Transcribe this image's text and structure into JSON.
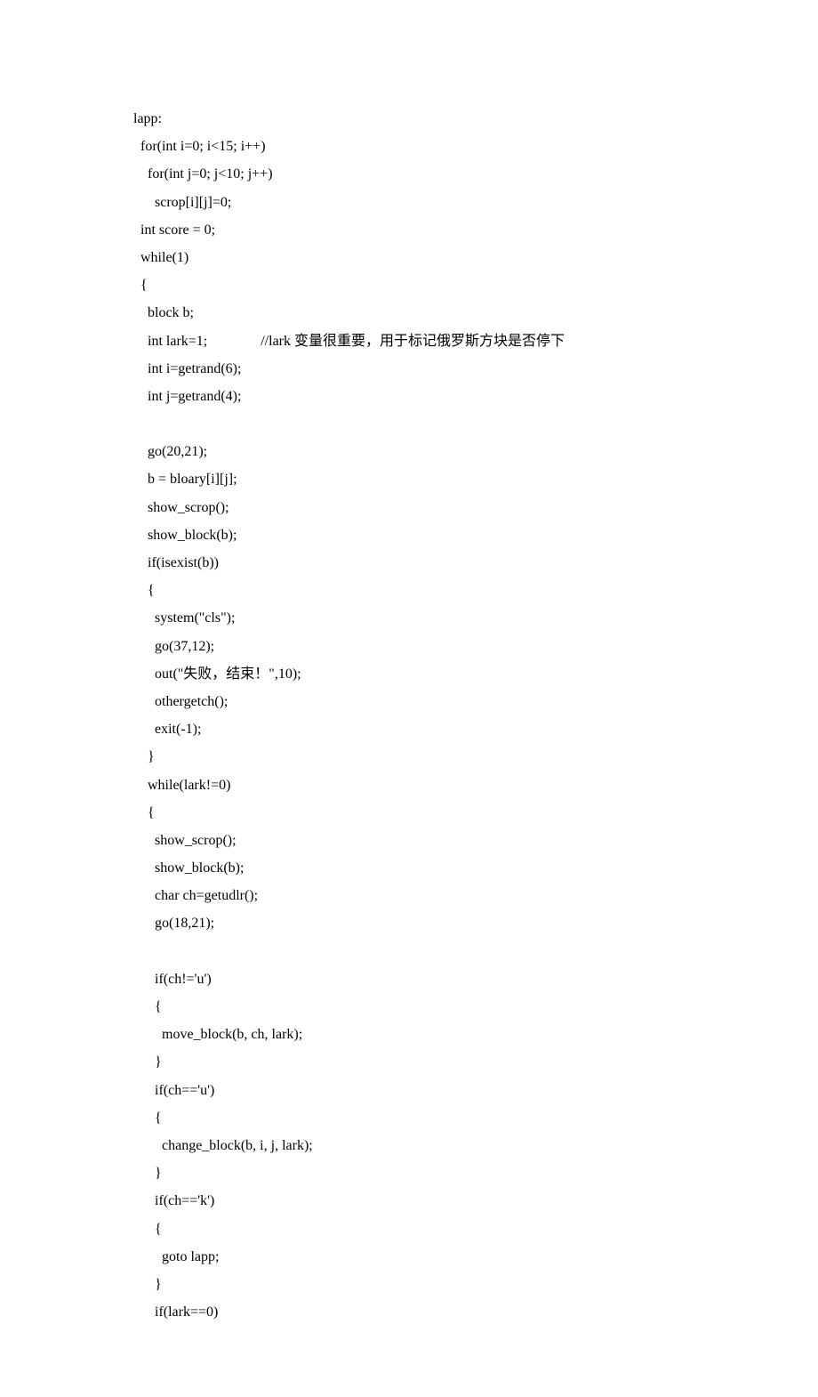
{
  "code": {
    "lines": [
      "lapp:",
      "  for(int i=0; i<15; i++)",
      "    for(int j=0; j<10; j++)",
      "      scrop[i][j]=0;",
      "  int score = 0;",
      "  while(1)",
      "  {",
      "    block b;",
      "    int lark=1;               //lark 变量很重要，用于标记俄罗斯方块是否停下",
      "    int i=getrand(6);",
      "    int j=getrand(4);",
      "",
      "    go(20,21);",
      "    b = bloary[i][j];",
      "    show_scrop();",
      "    show_block(b);",
      "    if(isexist(b))",
      "    {",
      "      system(\"cls\");",
      "      go(37,12);",
      "      out(\"失败，结束！\",10);",
      "      othergetch();",
      "      exit(-1);",
      "    }",
      "    while(lark!=0)",
      "    {",
      "      show_scrop();",
      "      show_block(b);",
      "      char ch=getudlr();",
      "      go(18,21);",
      "",
      "      if(ch!='u')",
      "      {",
      "        move_block(b, ch, lark);",
      "      }",
      "      if(ch=='u')",
      "      {",
      "        change_block(b, i, j, lark);",
      "      }",
      "      if(ch=='k')",
      "      {",
      "        goto lapp;",
      "      }",
      "      if(lark==0)"
    ]
  }
}
